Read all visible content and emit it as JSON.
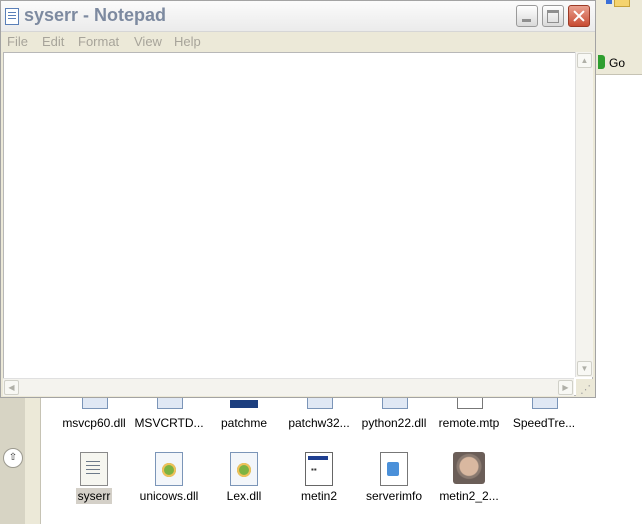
{
  "notepad": {
    "title": "syserr - Notepad",
    "menu": [
      "File",
      "Edit",
      "Format",
      "View",
      "Help"
    ],
    "content": ""
  },
  "explorer": {
    "go_label": "Go",
    "files_row1": [
      {
        "label": "msvcp60.dll",
        "type": "dll"
      },
      {
        "label": "MSVCRTD...",
        "type": "dll"
      },
      {
        "label": "patchme",
        "type": "blue"
      },
      {
        "label": "patchw32...",
        "type": "dll"
      },
      {
        "label": "python22.dll",
        "type": "dll"
      },
      {
        "label": "remote.mtp",
        "type": "paper"
      },
      {
        "label": "SpeedTre...",
        "type": "dll"
      }
    ],
    "files_row2": [
      {
        "label": "syserr",
        "type": "text",
        "selected": true
      },
      {
        "label": "unicows.dll",
        "type": "dll"
      },
      {
        "label": "Lex.dll",
        "type": "dll"
      },
      {
        "label": "metin2",
        "type": "exe"
      },
      {
        "label": "serverimfo",
        "type": "doc"
      },
      {
        "label": "metin2_2...",
        "type": "image"
      }
    ]
  },
  "icons": {
    "notepad": "notepad-icon",
    "minimize": "minimize-icon",
    "maximize": "maximize-icon",
    "close": "close-icon",
    "go": "go-arrow-icon",
    "collapse": "collapse-chevron-icon"
  }
}
